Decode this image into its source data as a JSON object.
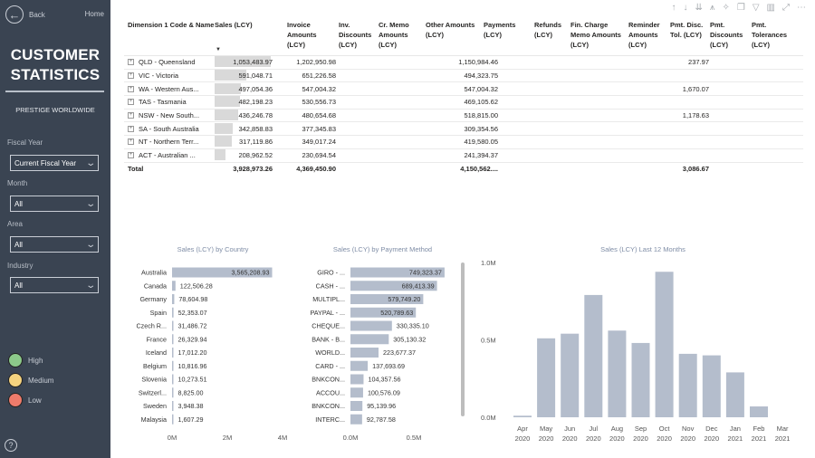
{
  "sidebar": {
    "back_label": "Back",
    "home_label": "Home",
    "title_line1": "CUSTOMER",
    "title_line2": "STATISTICS",
    "company": "PRESTIGE WORLDWIDE",
    "filters": [
      {
        "label": "Fiscal Year",
        "value": "Current Fiscal Year"
      },
      {
        "label": "Month",
        "value": "All"
      },
      {
        "label": "Area",
        "value": "All"
      },
      {
        "label": "Industry",
        "value": "All"
      }
    ],
    "legend": [
      {
        "label": "High",
        "color": "#8cc98a"
      },
      {
        "label": "Medium",
        "color": "#f5d37f"
      },
      {
        "label": "Low",
        "color": "#ee7b6b"
      }
    ],
    "help_icon": "?"
  },
  "toolbar": {
    "icons": [
      "sort-ascending-icon",
      "sort-descending-icon",
      "expand-all-icon",
      "drill-down-icon",
      "pin-icon",
      "copy-icon",
      "filter-icon",
      "analyze-icon",
      "focus-mode-icon",
      "more-options-icon"
    ],
    "glyphs": [
      "↑",
      "↓",
      "⇊",
      "⩚",
      "✧",
      "❐",
      "▽",
      "▥",
      "⤢",
      "⋯"
    ]
  },
  "matrix": {
    "headers": [
      "Dimension 1 Code & Name",
      "Sales (LCY)",
      "Invoice Amounts (LCY)",
      "Inv. Discounts (LCY)",
      "Cr. Memo Amounts (LCY)",
      "Other Amounts (LCY)",
      "Payments (LCY)",
      "Refunds (LCY)",
      "Fin. Charge Memo Amounts (LCY)",
      "Reminder Amounts (LCY)",
      "Pmt. Disc. Tol. (LCY)",
      "Pmt. Discounts (LCY)",
      "Pmt. Tolerances (LCY)"
    ],
    "sort_indicator": "▼",
    "rows": [
      {
        "name": "QLD - Queensland",
        "sales": "1,053,483.97",
        "sales_fraction": 1.0,
        "invoice": "1,202,950.98",
        "payments": "1,150,984.46",
        "pmt_discounts": "237.97"
      },
      {
        "name": "VIC - Victoria",
        "sales": "591,048.71",
        "sales_fraction": 0.561,
        "invoice": "651,226.58",
        "payments": "494,323.75",
        "pmt_discounts": ""
      },
      {
        "name": "WA - Western Aus...",
        "sales": "497,054.36",
        "sales_fraction": 0.472,
        "invoice": "547,004.32",
        "payments": "547,004.32",
        "pmt_discounts": "1,670.07"
      },
      {
        "name": "TAS - Tasmania",
        "sales": "482,198.23",
        "sales_fraction": 0.458,
        "invoice": "530,556.73",
        "payments": "469,105.62",
        "pmt_discounts": ""
      },
      {
        "name": "NSW - New South...",
        "sales": "436,246.78",
        "sales_fraction": 0.414,
        "invoice": "480,654.68",
        "payments": "518,815.00",
        "pmt_discounts": "1,178.63"
      },
      {
        "name": "SA - South Australia",
        "sales": "342,858.83",
        "sales_fraction": 0.325,
        "invoice": "377,345.83",
        "payments": "309,354.56",
        "pmt_discounts": ""
      },
      {
        "name": "NT - Northern Terr...",
        "sales": "317,119.86",
        "sales_fraction": 0.301,
        "invoice": "349,017.24",
        "payments": "419,580.05",
        "pmt_discounts": ""
      },
      {
        "name": "ACT - Australian ...",
        "sales": "208,962.52",
        "sales_fraction": 0.198,
        "invoice": "230,694.54",
        "payments": "241,394.37",
        "pmt_discounts": ""
      }
    ],
    "total": {
      "name": "Total",
      "sales": "3,928,973.26",
      "invoice": "4,369,450.90",
      "payments": "4,150,562....",
      "pmt_discounts": "3,086.67"
    }
  },
  "chart_data": [
    {
      "type": "bar",
      "orientation": "horizontal",
      "title": "Sales (LCY) by Country",
      "categories": [
        "Australia",
        "Canada",
        "Germany",
        "Spain",
        "Czech R...",
        "France",
        "Iceland",
        "Belgium",
        "Slovenia",
        "Switzerl...",
        "Sweden",
        "Malaysia"
      ],
      "values": [
        3565208.93,
        122506.28,
        78604.98,
        52353.07,
        31486.72,
        26329.94,
        17012.2,
        10816.96,
        10273.51,
        8825.0,
        3948.38,
        1607.29
      ],
      "labels": [
        "3,565,208.93",
        "122,506.28",
        "78,604.98",
        "52,353.07",
        "31,486.72",
        "26,329.94",
        "17,012.20",
        "10,816.96",
        "10,273.51",
        "8,825.00",
        "3,948.38",
        "1,607.29"
      ],
      "xticks": [
        "0M",
        "2M",
        "4M"
      ],
      "xlim": [
        0,
        4000000
      ],
      "color": "#b4bdcc"
    },
    {
      "type": "bar",
      "orientation": "horizontal",
      "title": "Sales (LCY) by Payment Method",
      "categories": [
        "GIRO - ...",
        "CASH - ...",
        "MULTIPL...",
        "PAYPAL - ...",
        "CHEQUE...",
        "BANK - B...",
        "WORLD...",
        "CARD - ...",
        "BNKCON...",
        "ACCOU...",
        "BNKCON...",
        "INTERC..."
      ],
      "values": [
        749323.37,
        689413.39,
        579749.2,
        520789.63,
        330335.1,
        305130.32,
        223677.37,
        137693.69,
        104357.56,
        100576.09,
        95139.96,
        92787.58
      ],
      "labels": [
        "749,323.37",
        "689,413.39",
        "579,749.20",
        "520,789.63",
        "330,335.10",
        "305,130.32",
        "223,677.37",
        "137,693.69",
        "104,357.56",
        "100,576.09",
        "95,139.96",
        "92,787.58"
      ],
      "xticks": [
        "0.0M",
        "0.5M"
      ],
      "xlim": [
        0,
        750000
      ],
      "color": "#b4bdcc"
    },
    {
      "type": "bar",
      "orientation": "vertical",
      "title": "Sales (LCY) Last 12 Months",
      "categories": [
        [
          "Apr",
          "2020"
        ],
        [
          "May",
          "2020"
        ],
        [
          "Jun",
          "2020"
        ],
        [
          "Jul",
          "2020"
        ],
        [
          "Aug",
          "2020"
        ],
        [
          "Sep",
          "2020"
        ],
        [
          "Oct",
          "2020"
        ],
        [
          "Nov",
          "2020"
        ],
        [
          "Dec",
          "2020"
        ],
        [
          "Jan",
          "2021"
        ],
        [
          "Feb",
          "2021"
        ],
        [
          "Mar",
          "2021"
        ]
      ],
      "values": [
        10000,
        510000,
        540000,
        790000,
        560000,
        480000,
        940000,
        410000,
        400000,
        290000,
        70000,
        0
      ],
      "yticks": [
        "0.0M",
        "0.5M",
        "1.0M"
      ],
      "ylim": [
        0,
        1000000
      ],
      "color": "#b4bdcc"
    }
  ]
}
